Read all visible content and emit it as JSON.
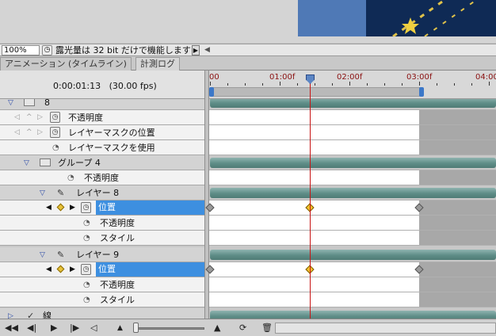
{
  "status_bar": {
    "zoom": "100%",
    "exposure_text": "露光量は 32 bit だけで機能します"
  },
  "tabs": [
    {
      "label": "アニメーション (タイムライン)"
    },
    {
      "label": "計測ログ"
    }
  ],
  "timeline": {
    "current_time": "0:00:01:13",
    "fps": "(30.00 fps)",
    "ruler_labels": [
      "00",
      "01:00f",
      "02:00f",
      "03:00f",
      "04:00"
    ]
  },
  "layers": [
    {
      "label": "8",
      "type": "group-partial"
    },
    {
      "label": "不透明度",
      "type": "property"
    },
    {
      "label": "レイヤーマスクの位置",
      "type": "property"
    },
    {
      "label": "レイヤーマスクを使用",
      "type": "property-sub"
    },
    {
      "label": "グループ 4",
      "type": "group"
    },
    {
      "label": "不透明度",
      "type": "property-sub2"
    },
    {
      "label": "レイヤー 8",
      "type": "layer"
    },
    {
      "label": "位置",
      "type": "selected"
    },
    {
      "label": "不透明度",
      "type": "property-sub3"
    },
    {
      "label": "スタイル",
      "type": "property-sub3"
    },
    {
      "label": "レイヤー 9",
      "type": "layer"
    },
    {
      "label": "位置",
      "type": "selected"
    },
    {
      "label": "不透明度",
      "type": "property-sub3"
    },
    {
      "label": "スタイル",
      "type": "property-sub3"
    },
    {
      "label": "線",
      "type": "layer-partial"
    }
  ],
  "colors": {
    "accent": "#3d8fe0",
    "playhead": "#c81414",
    "keyframe_current": "#f2c12e"
  }
}
